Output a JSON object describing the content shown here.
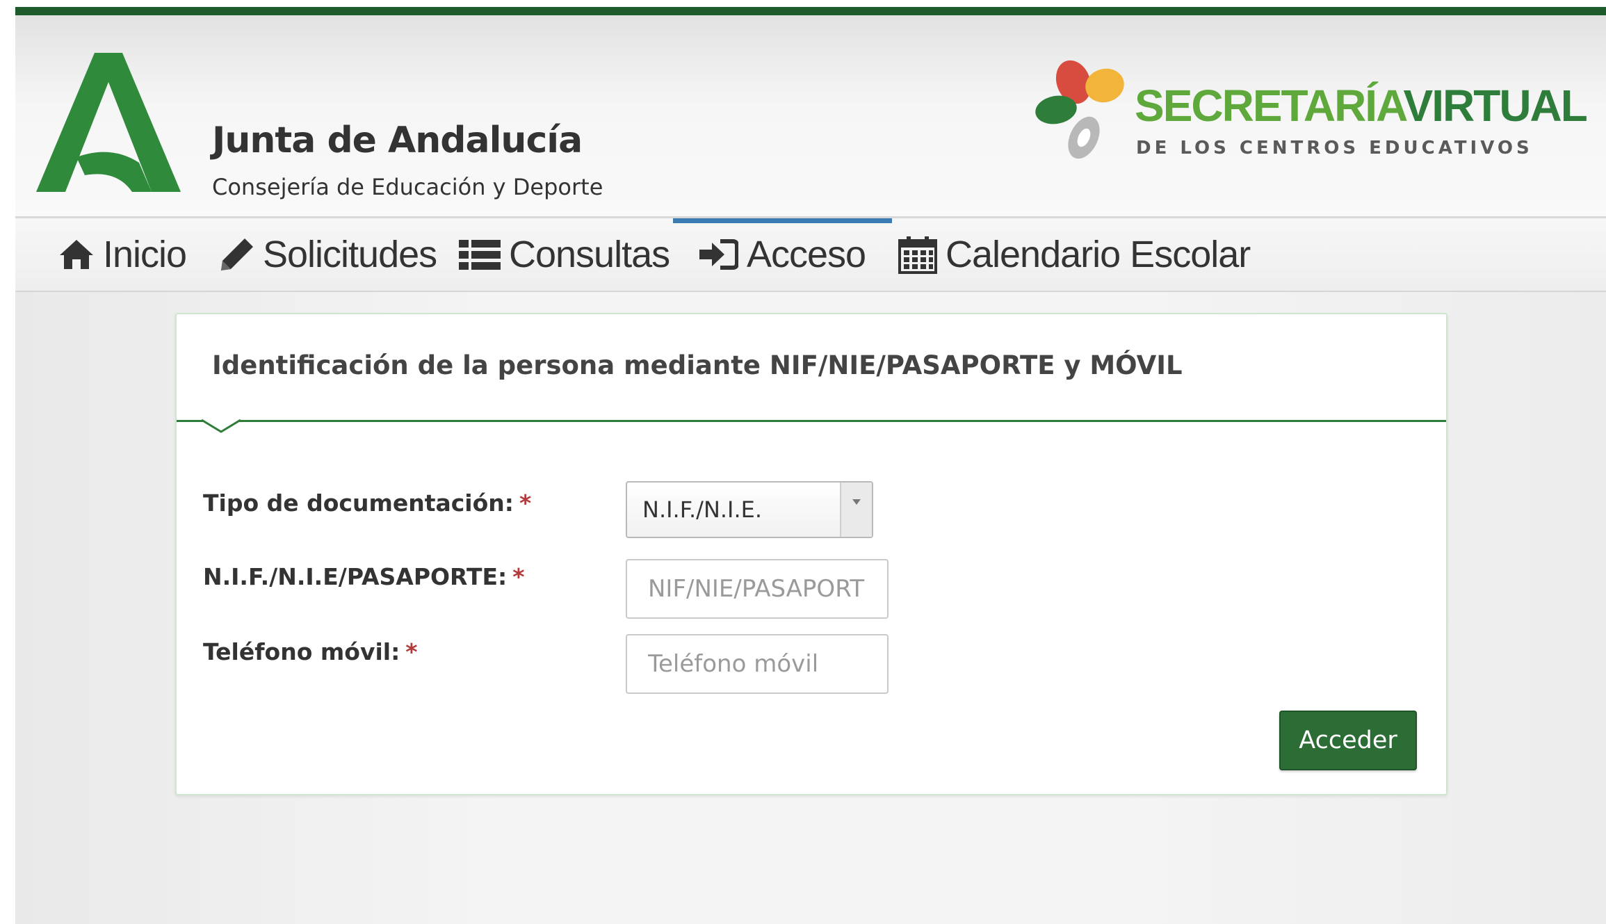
{
  "header": {
    "org_title": "Junta de Andalucía",
    "org_subtitle": "Consejería de Educación y Deporte",
    "app_title_part1": "SECRETARÍA",
    "app_title_part2": "VIRTUAL",
    "app_subtitle": "DE LOS CENTROS EDUCATIVOS"
  },
  "nav": {
    "items": [
      {
        "label": "Inicio",
        "icon": "home-icon"
      },
      {
        "label": "Solicitudes",
        "icon": "pencil-icon"
      },
      {
        "label": "Consultas",
        "icon": "list-icon"
      },
      {
        "label": "Acceso",
        "icon": "sign-in-icon",
        "active": true
      },
      {
        "label": "Calendario Escolar",
        "icon": "calendar-icon"
      }
    ]
  },
  "form": {
    "title": "Identificación de la persona mediante NIF/NIE/PASAPORTE y MÓVIL",
    "required_mark": "*",
    "doc_type": {
      "label": "Tipo de documentación:",
      "selected": "N.I.F./N.I.E."
    },
    "doc_number": {
      "label": "N.I.F./N.I.E/PASAPORTE:",
      "placeholder": "NIF/NIE/PASAPORTE",
      "value": ""
    },
    "phone": {
      "label": "Teléfono móvil:",
      "placeholder": "Teléfono móvil",
      "value": ""
    },
    "submit_label": "Acceder"
  },
  "colors": {
    "brand_green": "#2b6d35",
    "top_bar": "#1e5b2c",
    "active_tab": "#3b7db3",
    "required": "#b23a3a"
  }
}
